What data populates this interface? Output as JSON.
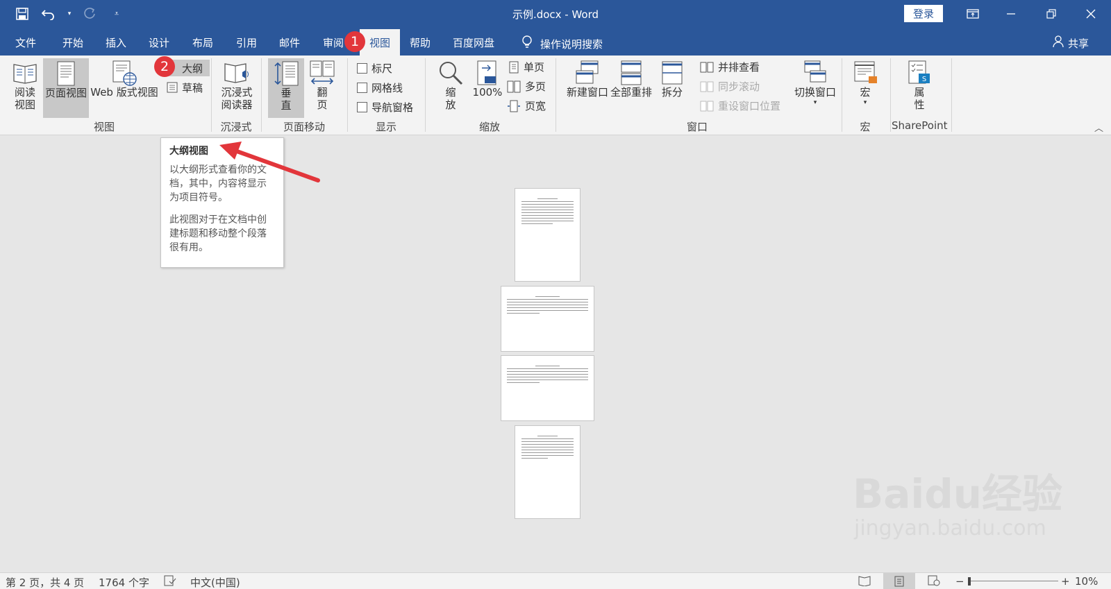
{
  "titlebar": {
    "doc_title": "示例.docx  -  Word",
    "login_label": "登录"
  },
  "tabs": [
    {
      "label": "文件"
    },
    {
      "label": "开始"
    },
    {
      "label": "插入"
    },
    {
      "label": "设计"
    },
    {
      "label": "布局"
    },
    {
      "label": "引用"
    },
    {
      "label": "邮件"
    },
    {
      "label": "审阅"
    },
    {
      "label": "视图"
    },
    {
      "label": "帮助"
    },
    {
      "label": "百度网盘"
    }
  ],
  "tellme": "操作说明搜索",
  "share": "共享",
  "ribbon": {
    "view": {
      "read_mode": "阅读\n视图",
      "print_layout": "页面视图",
      "web_layout": "Web 版式视图",
      "outline": "大纲",
      "draft": "草稿",
      "group": "视图"
    },
    "immersive": {
      "reader": "沉浸式\n阅读器",
      "group": "沉浸式"
    },
    "page_move": {
      "vertical": "垂\n直",
      "side": "翻\n页",
      "group": "页面移动"
    },
    "show": {
      "ruler": "标尺",
      "gridlines": "网格线",
      "nav_pane": "导航窗格",
      "group": "显示"
    },
    "zoom": {
      "zoom": "缩\n放",
      "hundred": "100%",
      "one_page": "单页",
      "multi_page": "多页",
      "page_width": "页宽",
      "group": "缩放"
    },
    "window": {
      "new_window": "新建窗口",
      "arrange_all": "全部重排",
      "split": "拆分",
      "side_by_side": "并排查看",
      "sync_scroll": "同步滚动",
      "reset_pos": "重设窗口位置",
      "switch": "切换窗口",
      "group": "窗口"
    },
    "macros": {
      "macro": "宏",
      "group": "宏"
    },
    "sharepoint": {
      "properties": "属\n性",
      "group": "SharePoint"
    }
  },
  "badges": {
    "one": "1",
    "two": "2"
  },
  "tooltip": {
    "title": "大纲视图",
    "p1": "以大纲形式查看你的文档，其中，内容将显示为项目符号。",
    "p2": "此视图对于在文档中创建标题和移动整个段落很有用。"
  },
  "statusbar": {
    "page": "第 2 页，共 4 页",
    "words": "1764 个字",
    "lang": "中文(中国)",
    "zoom": "10%"
  },
  "watermark": {
    "brand": "Baidu经验",
    "url": "jingyan.baidu.com"
  }
}
